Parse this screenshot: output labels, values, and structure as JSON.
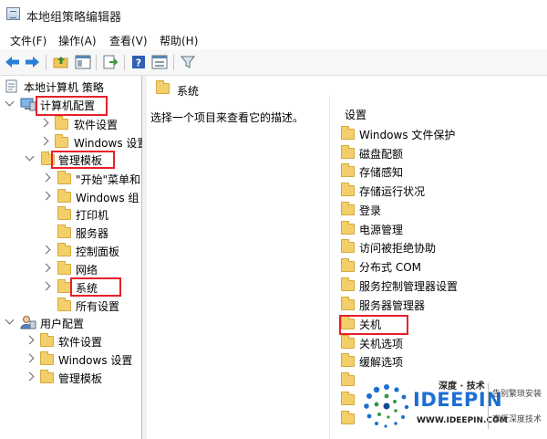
{
  "window": {
    "title": "本地组策略编辑器"
  },
  "menu": [
    "文件(F)",
    "操作(A)",
    "查看(V)",
    "帮助(H)"
  ],
  "toolbar": [
    "back-icon",
    "forward-icon",
    "up-folder-icon",
    "show-hide-tree-icon",
    "export-list-icon",
    "help-icon",
    "properties-icon",
    "filter-icon"
  ],
  "tree": {
    "root": "本地计算机 策略",
    "computer_config": "计算机配置",
    "cc_software": "软件设置",
    "cc_windows": "Windows 设置",
    "admin_templates": "管理模板",
    "start_menu": "\"开始\"菜单和",
    "windows_components": "Windows 组",
    "printers": "打印机",
    "servers": "服务器",
    "control_panel": "控制面板",
    "network": "网络",
    "system": "系统",
    "all_settings": "所有设置",
    "user_config": "用户配置",
    "uc_software": "软件设置",
    "uc_windows": "Windows 设置",
    "uc_admin": "管理模板"
  },
  "content": {
    "header": "系统",
    "description": "选择一个项目来查看它的描述。",
    "column_header": "设置",
    "items": [
      "Windows 文件保护",
      "磁盘配额",
      "存储感知",
      "存储运行状况",
      "登录",
      "电源管理",
      "访问被拒绝协助",
      "分布式 COM",
      "服务控制管理器设置",
      "服务器管理器",
      "关机",
      "关机选项",
      "缓解选项",
      "",
      "",
      ""
    ]
  },
  "watermark": {
    "top": "深度 · 技术",
    "brand": "IDEEPIN",
    "url": "WWW.IDEEPIN.COM",
    "slogan1": "告别繁琐安装",
    "slogan2": "享受深度技术"
  },
  "colors": {
    "highlight": "#e8202a",
    "folder": "#f3cf6b",
    "brand_blue": "#1c6fd1"
  }
}
